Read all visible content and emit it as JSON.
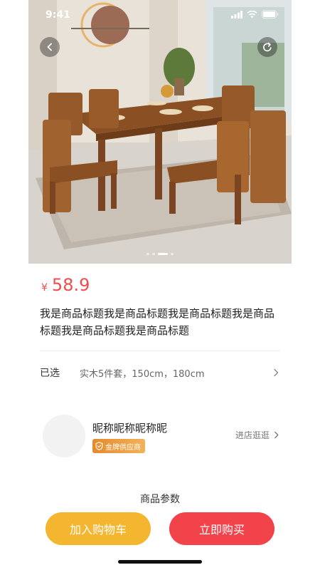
{
  "status_bar": {
    "time": "9:41"
  },
  "product": {
    "currency_symbol": "¥",
    "price": "58.9",
    "title": "我是商品标题我是商品标题我是商品标题我是商品标题我是商品标题我是商品标题",
    "spec_label": "已选",
    "spec_value": "实木5件套，150cm，180cm"
  },
  "carousel": {
    "count": 4,
    "active_index": 2
  },
  "shop": {
    "name": "昵称昵称昵称昵",
    "badge": "金牌供应商",
    "link_label": "进店逛逛"
  },
  "section": {
    "params_title": "商品参数"
  },
  "actions": {
    "add_to_cart": "加入购物车",
    "buy_now": "立即购买"
  },
  "colors": {
    "price": "#ef4d4d",
    "cart_button": "#f4b52f",
    "buy_button": "#f2424a",
    "badge_start": "#e58a2c",
    "badge_end": "#f3b25a"
  },
  "icons": {
    "back": "chevron-left-icon",
    "share": "share-icon",
    "spec_arrow": "chevron-right-icon",
    "shop_arrow": "chevron-right-icon",
    "badge": "shield-check-icon",
    "signal": "signal-icon",
    "wifi": "wifi-icon",
    "battery": "battery-icon"
  }
}
